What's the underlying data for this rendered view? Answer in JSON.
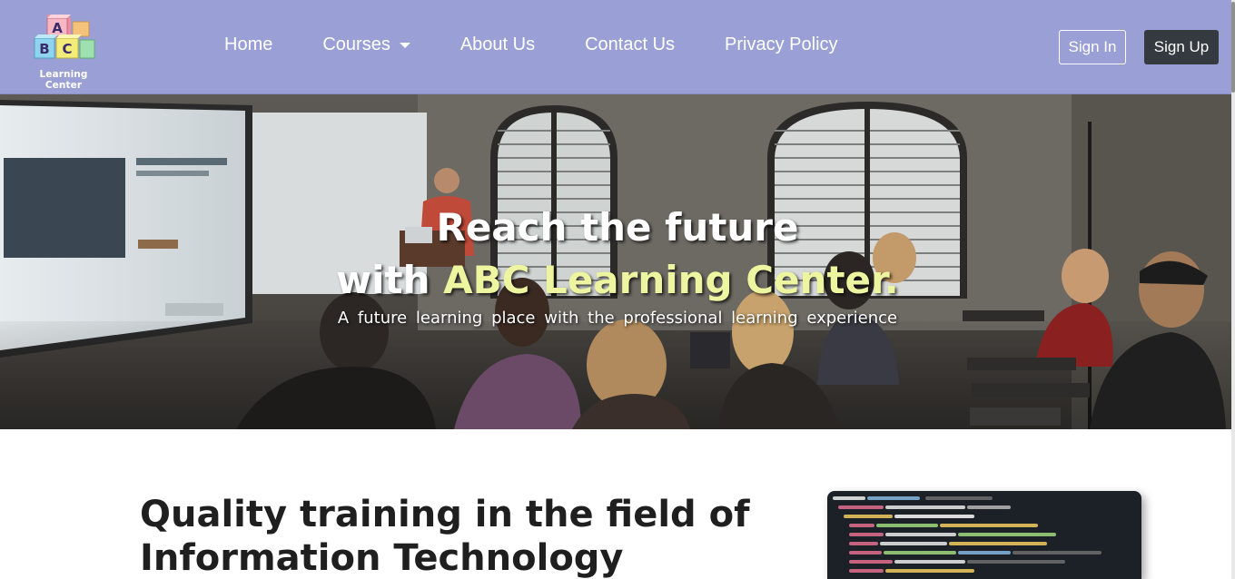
{
  "brand": {
    "block_letters": [
      "A",
      "B",
      "C"
    ],
    "name": "Learning Center"
  },
  "nav": {
    "items": [
      {
        "label": "Home"
      },
      {
        "label": "Courses",
        "has_dropdown": true
      },
      {
        "label": "About Us"
      },
      {
        "label": "Contact Us"
      },
      {
        "label": "Privacy Policy"
      }
    ],
    "sign_in": "Sign In",
    "sign_up": "Sign Up"
  },
  "hero": {
    "title_line1": "Reach the future",
    "title_line2_prefix": "with ",
    "title_line2_accent": "ABC Learning Center.",
    "subtitle": "A future learning place with the professional learning experience"
  },
  "section": {
    "headline_line1": "Quality training in the field of",
    "headline_line2": "Information Technology"
  },
  "colors": {
    "navbar": "#9a9fd6",
    "accent_text": "#eef5a0",
    "signup_button": "#343a40"
  }
}
